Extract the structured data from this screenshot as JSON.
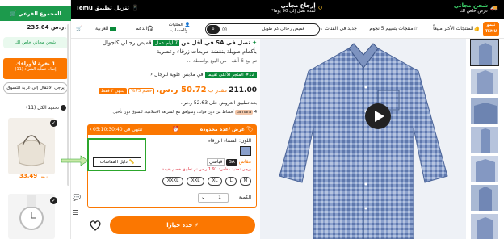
{
  "colors": {
    "accent": "#fb7701",
    "green": "#1c9a4c",
    "dark": "#000000",
    "guide_box": "#2ca62c"
  },
  "topbar": {
    "free_ship_title": "شحن مجاني",
    "free_ship_sub": "عرض خاص لك",
    "returns_title": "إرجاع مجاني",
    "returns_sub": "لمدة تصل إلى 90 يوما*",
    "app_label": "تنزيل تطبيق Temu"
  },
  "nav": {
    "logo": "تيمو",
    "logo_sub": "TEMU",
    "best_sellers": "المنتجات الأكثر مبيعاً",
    "five_star": "منتجات بتقييم 5 نجوم",
    "new": "جديد في",
    "categories": "الفئات",
    "search_query": "قميص رجالي كم طويل",
    "orders": "الطلبات والحساب",
    "support": "الدعم",
    "language": "العربية"
  },
  "cart": {
    "header": "المجموع الفرعي",
    "subtotal": "235.64 ر.س.",
    "free_shipping": "شحن مجاني خاص لك",
    "orange_title": "1 نقرة لأوراقك",
    "orange_sub": "إتمام عملية الشراء (11)",
    "goto_cart": "يرجى الانتقال إلى عربة التسوق",
    "select_all": "تحديد الكل (11)",
    "item1_price": "33.49",
    "item1_currency": "ر.س."
  },
  "product": {
    "title_prefix": "تصل في SA في أقل من",
    "title_badge": "7 أيام عمل",
    "title_rest": "قميص رجالي كاجوال بأكمام طويلة بنقشة مربعات زرقاء وعصرية",
    "sold": "تم بيع 6 ألف | من البيع بواسطة ...",
    "best_tag": "#12 المتجر الأعلى تقييماً",
    "best_cat": "في ملابس علوية للرجال",
    "old_price": "211.00",
    "price_label": "مقدر ب",
    "price": "50.72 ر.س.",
    "discount_pct": "خصم 75%",
    "limited": "ينتهي ٣ فقط",
    "after_offers": "بعد تطبيق العروض على 52.63 ر.س.",
    "tamara": "tamara",
    "tamara_text": "4 أقساط من دون فوائد، ومتوافق مع الشريعة الإسلامية، لتسوق دون تأخير.",
    "deal_title": "عرض /عدة محدودة",
    "deal_timer": "تنتهي في 05:10:30:40",
    "color_label": "اللون: السماء الزرقاء",
    "size_label": "مقاس",
    "size_region": "SA",
    "size_std": "قياسي",
    "size_guide": "دليل المقاسات",
    "size_warning": "يرجى تحديد مقاس: 1.91 ر.س تم تطبيق خصم بقيمة",
    "sizes": [
      "M",
      "L",
      "XL",
      "XXL",
      "XXXL"
    ],
    "qty_label": "الكمية",
    "qty_value": "1",
    "add_to_cart": "حدد خيارًا"
  }
}
